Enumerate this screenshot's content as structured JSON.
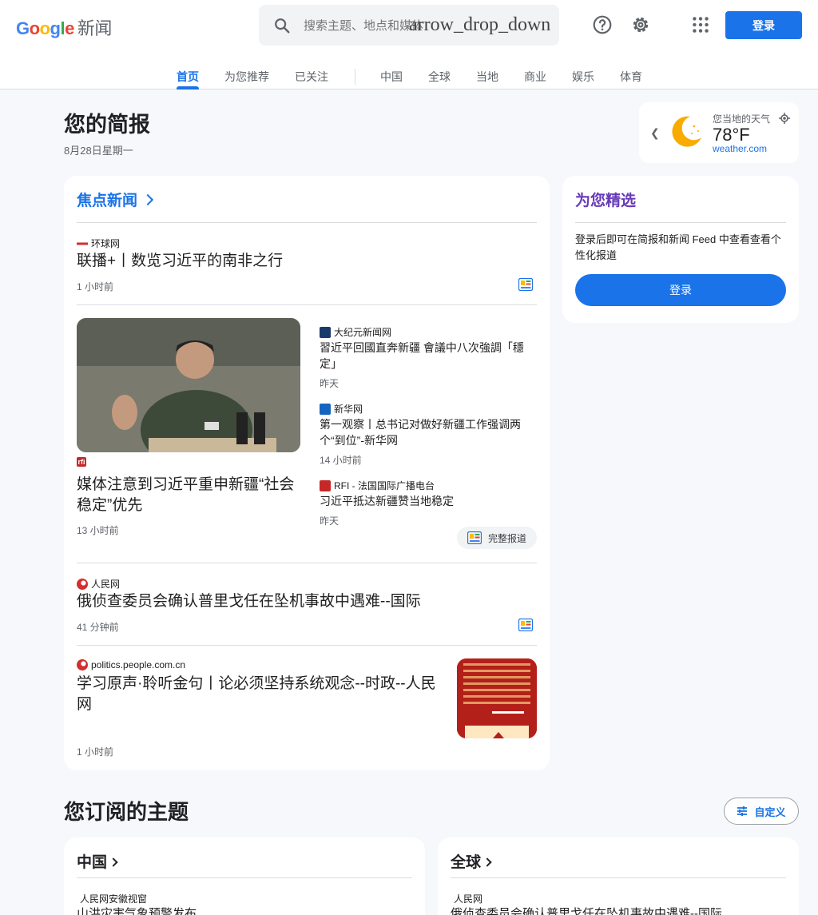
{
  "header": {
    "logo_google": "Google",
    "logo_news": "新闻",
    "search_placeholder": "搜索主题、地点和媒体",
    "search_overlay_text": "arrow_drop_down",
    "signin_label": "登录"
  },
  "tabs": [
    {
      "label": "首页",
      "active": true
    },
    {
      "label": "为您推荐"
    },
    {
      "label": "已关注"
    },
    {
      "label": "中国"
    },
    {
      "label": "全球"
    },
    {
      "label": "当地"
    },
    {
      "label": "商业"
    },
    {
      "label": "娱乐"
    },
    {
      "label": "体育"
    }
  ],
  "briefing": {
    "title": "您的简报",
    "date": "8月28日星期一"
  },
  "weather": {
    "label": "您当地的天气",
    "temp": "78°F",
    "source": "weather.com"
  },
  "headlines": {
    "title": "焦点新闻",
    "story1": {
      "source": "环球网",
      "title": "联播+丨数览习近平的南非之行",
      "time": "1 小时前"
    },
    "cluster": {
      "main_source": "RFI",
      "main_title": "媒体注意到习近平重申新疆“社会稳定”优先",
      "main_time": "13 小时前",
      "sub": [
        {
          "source": "大纪元新闻网",
          "title": "習近平回國直奔新疆 會議中八次強調「穩定」",
          "time": "昨天"
        },
        {
          "source": "新华网",
          "title": "第一观察丨总书记对做好新疆工作强调两个“到位”-新华网",
          "time": "14 小时前"
        },
        {
          "source": "RFI - 法国国际广播电台",
          "title": "习近平抵达新疆赞当地稳定",
          "time": "昨天"
        }
      ],
      "full_coverage_label": "完整报道"
    },
    "story3": {
      "source": "人民网",
      "title": "俄侦查委员会确认普里戈任在坠机事故中遇难--国际",
      "time": "41 分钟前"
    },
    "story4": {
      "source": "politics.people.com.cn",
      "title": "学习原声·聆听金句丨论必须坚持系统观念--时政--人民网",
      "time": "1 小时前"
    }
  },
  "picks": {
    "title": "为您精选",
    "text": "登录后即可在简报和新闻 Feed 中查看查看个性化报道",
    "button_label": "登录"
  },
  "topics": {
    "title": "您订阅的主题",
    "customize_label": "自定义",
    "cards": [
      {
        "title": "中国",
        "source": "人民网安徽视窗",
        "headline": "山洪灾害气象预警发布"
      },
      {
        "title": "全球",
        "source": "人民网",
        "headline": "俄侦查委员会确认普里戈任在坠机事故中遇难--国际"
      }
    ]
  },
  "colors": {
    "accent": "#1a73e8",
    "background": "#f6f8fc",
    "moon": "#f9ab00"
  }
}
